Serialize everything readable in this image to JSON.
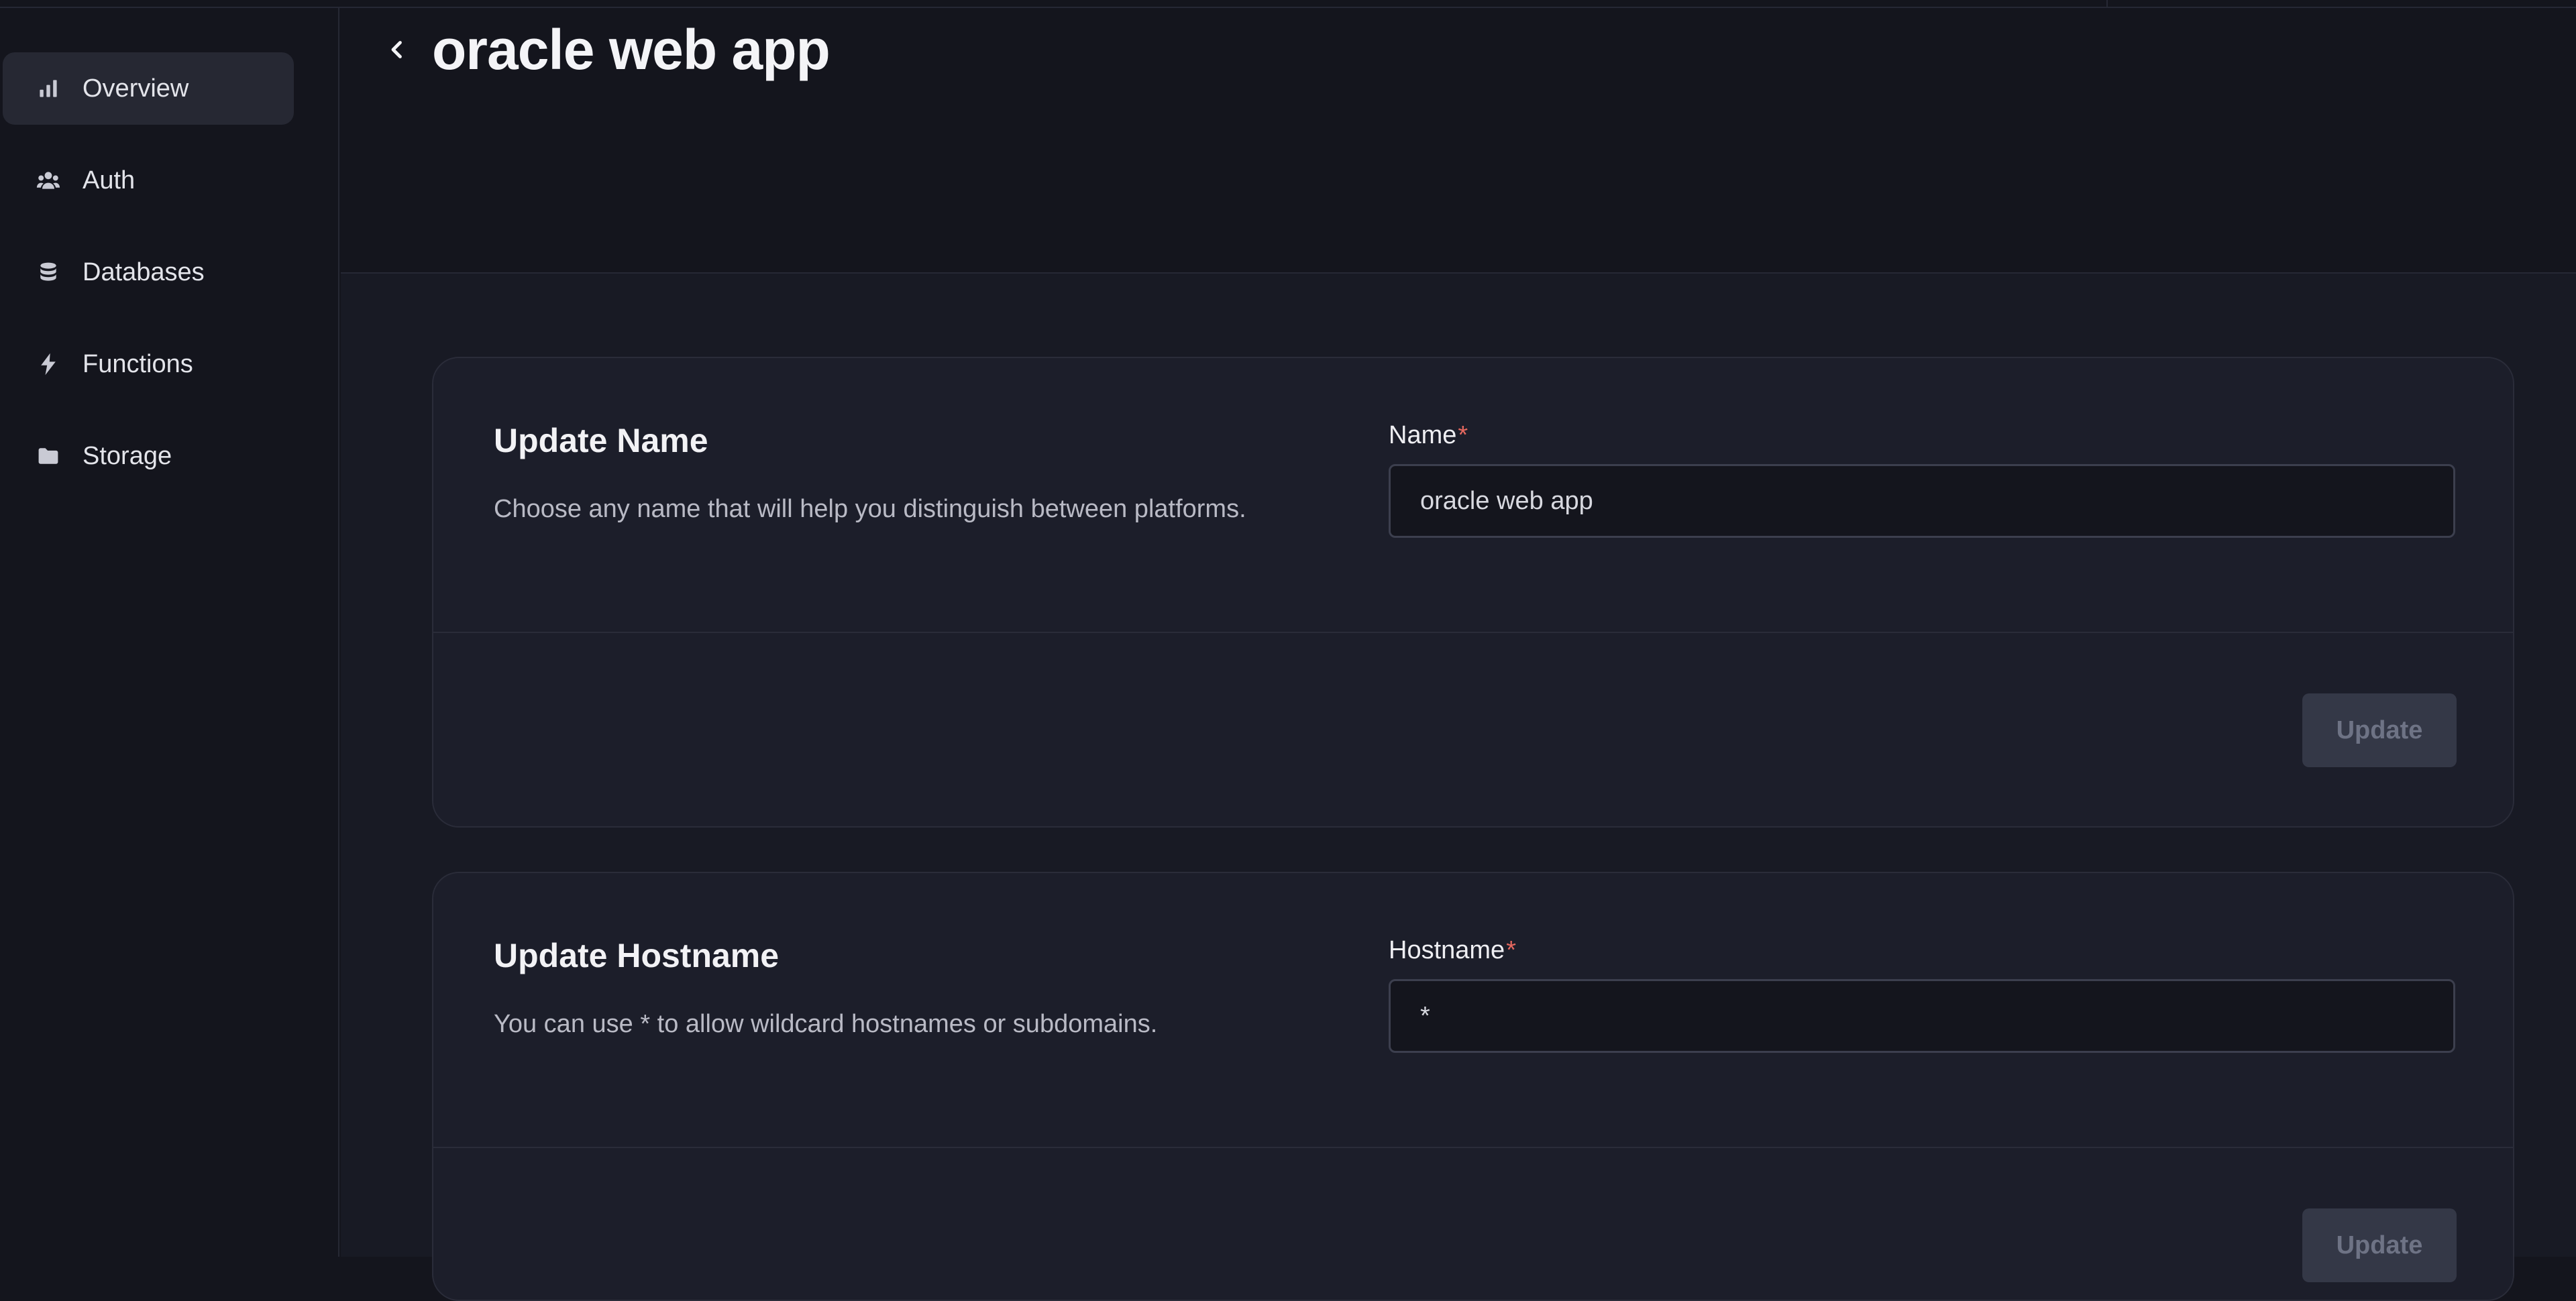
{
  "sidebar": {
    "items": [
      {
        "label": "Overview",
        "icon": "bar-chart-icon",
        "active": true
      },
      {
        "label": "Auth",
        "icon": "users-icon",
        "active": false
      },
      {
        "label": "Databases",
        "icon": "database-icon",
        "active": false
      },
      {
        "label": "Functions",
        "icon": "lightning-icon",
        "active": false
      },
      {
        "label": "Storage",
        "icon": "folder-icon",
        "active": false
      }
    ]
  },
  "header": {
    "title": "oracle web app",
    "back_icon": "chevron-left-icon"
  },
  "cards": {
    "name": {
      "title": "Update Name",
      "description": "Choose any name that will help you distinguish between platforms.",
      "field_label": "Name",
      "required_mark": "*",
      "value": "oracle web app",
      "button": "Update"
    },
    "hostname": {
      "title": "Update Hostname",
      "description": "You can use * to allow wildcard hostnames or subdomains.",
      "field_label": "Hostname",
      "required_mark": "*",
      "value": "*",
      "button": "Update"
    }
  },
  "colors": {
    "background": "#14151d",
    "panel": "#1c1e2a",
    "required": "#e5685f",
    "button_disabled": "#343847"
  }
}
